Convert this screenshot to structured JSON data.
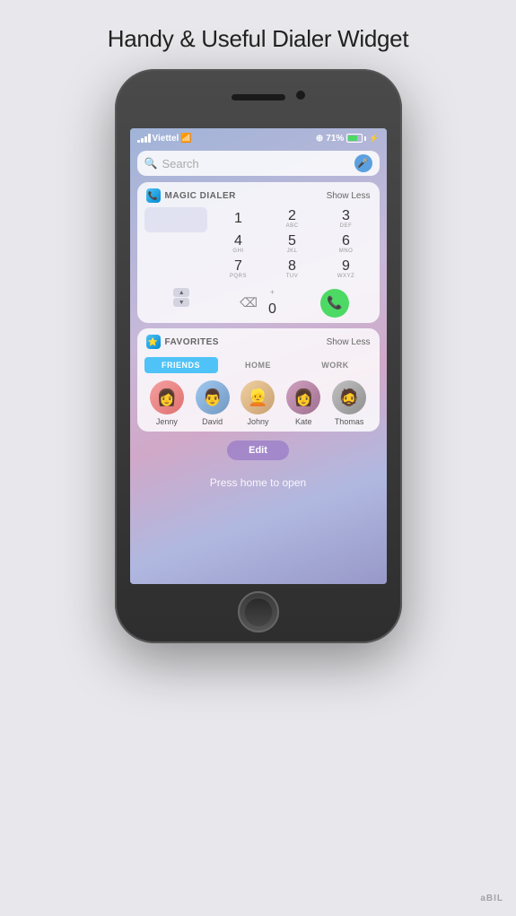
{
  "page": {
    "title": "Handy & Useful Dialer Widget"
  },
  "status_bar": {
    "carrier": "Viettel",
    "battery": "71%",
    "signal_label": "signal"
  },
  "search": {
    "placeholder": "Search"
  },
  "dialer_widget": {
    "title": "MAGIC DIALER",
    "action": "Show Less",
    "icon": "📞",
    "keys": [
      {
        "main": "1",
        "sub": ""
      },
      {
        "main": "2",
        "sub": "ABC"
      },
      {
        "main": "3",
        "sub": "DEF"
      },
      {
        "main": "4",
        "sub": "GHI"
      },
      {
        "main": "5",
        "sub": "JKL"
      },
      {
        "main": "6",
        "sub": "MNO"
      },
      {
        "main": "7",
        "sub": "PQRS"
      },
      {
        "main": "8",
        "sub": "TUV"
      },
      {
        "main": "9",
        "sub": "WXYZ"
      }
    ],
    "zero": "0",
    "zero_plus": "+"
  },
  "favorites_widget": {
    "title": "FAVORITES",
    "action": "Show Less",
    "tabs": [
      {
        "label": "FRIENDS",
        "active": true
      },
      {
        "label": "HOME",
        "active": false
      },
      {
        "label": "WORK",
        "active": false
      }
    ],
    "contacts": [
      {
        "name": "Jenny",
        "av_class": "av1",
        "emoji": "👩"
      },
      {
        "name": "David",
        "av_class": "av2",
        "emoji": "👨"
      },
      {
        "name": "Johny",
        "av_class": "av3",
        "emoji": "👱"
      },
      {
        "name": "Kate",
        "av_class": "av4",
        "emoji": "👩"
      },
      {
        "name": "Thomas",
        "av_class": "av5",
        "emoji": "🧔"
      }
    ]
  },
  "edit_button": {
    "label": "Edit"
  },
  "footer": {
    "press_home": "Press home to open"
  },
  "logo": {
    "text": "aBIL"
  }
}
